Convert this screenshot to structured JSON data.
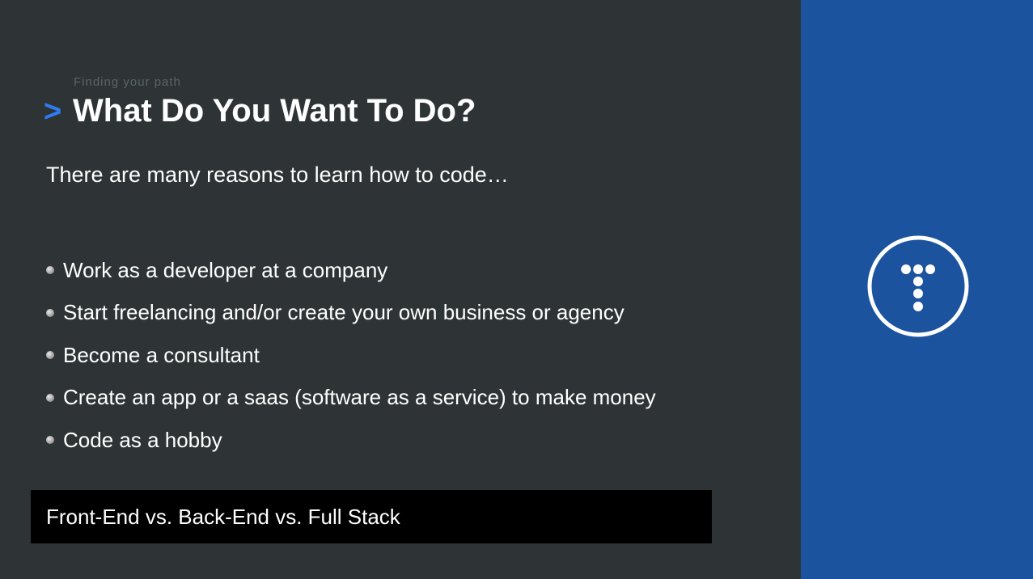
{
  "slide": {
    "eyebrow": "Finding your path",
    "chevron": ">",
    "title": "What Do You Want To Do?",
    "intro": "There are many reasons to learn how to code…",
    "bullets": [
      "Work as a developer at a company",
      "Start freelancing and/or create your own business or agency",
      "Become a consultant",
      "Create an app or a saas (software as a service) to make money",
      "Code as a hobby"
    ],
    "caption": "Front-End vs. Back-End vs. Full Stack"
  },
  "brand": {
    "logo_icon": "traversy-logo-icon",
    "accent_color": "#2f7cf2",
    "panel_color": "#1b539e",
    "background_color": "#2e3436"
  }
}
